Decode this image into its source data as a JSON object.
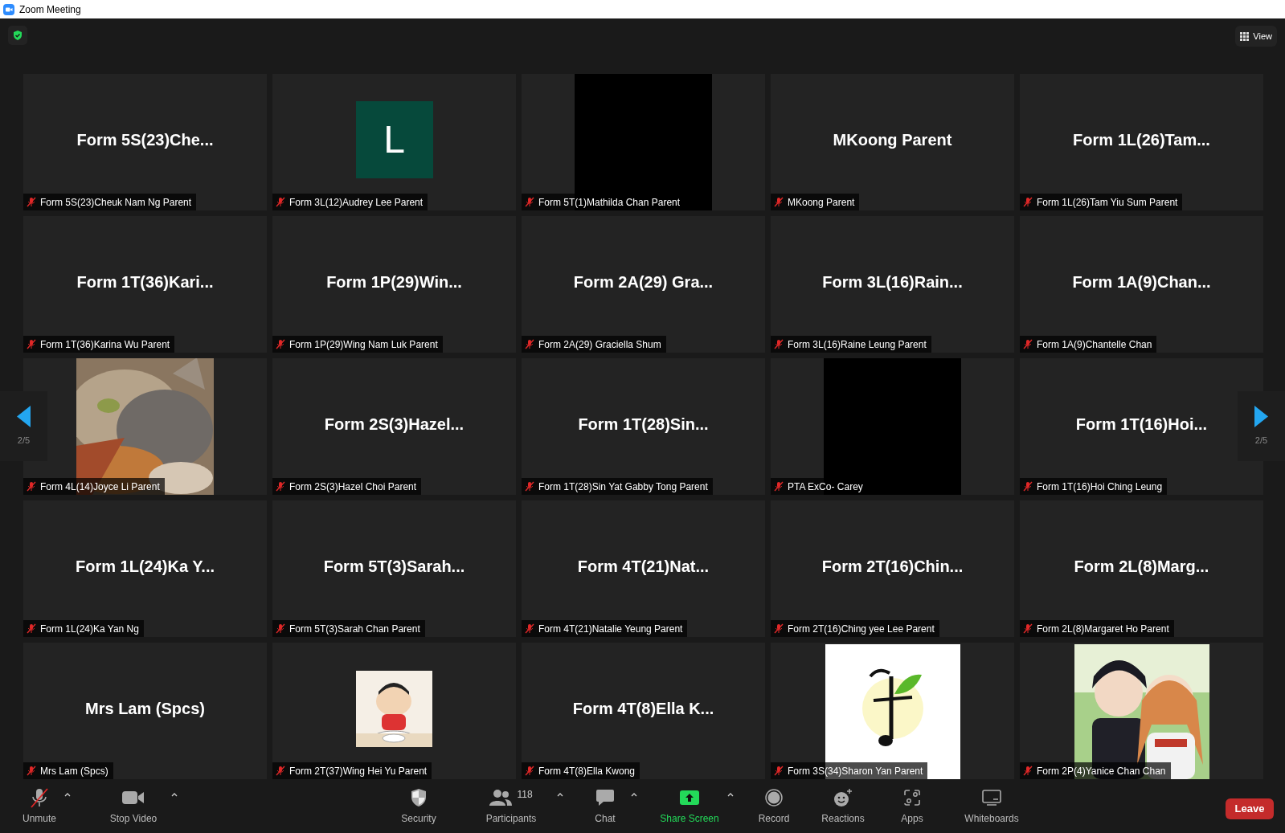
{
  "window": {
    "title": "Zoom Meeting"
  },
  "view_button": {
    "label": "View"
  },
  "pager": {
    "left": "2/5",
    "right": "2/5"
  },
  "tiles": [
    {
      "kind": "name",
      "display_name": "Form 5S(23)Che...",
      "label": "Form 5S(23)Cheuk Nam Ng Parent",
      "muted": true
    },
    {
      "kind": "avatar",
      "display_name": "L",
      "label": "Form 3L(12)Audrey Lee Parent",
      "muted": true
    },
    {
      "kind": "black_video",
      "label": "Form 5T(1)Mathilda Chan Parent",
      "muted": true
    },
    {
      "kind": "name",
      "display_name": "MKoong Parent",
      "label": "MKoong Parent",
      "muted": true
    },
    {
      "kind": "name",
      "display_name": "Form 1L(26)Tam...",
      "label": "Form 1L(26)Tam Yiu Sum Parent",
      "muted": true
    },
    {
      "kind": "name",
      "display_name": "Form 1T(36)Kari...",
      "label": "Form 1T(36)Karina Wu Parent",
      "muted": true
    },
    {
      "kind": "name",
      "display_name": "Form 1P(29)Win...",
      "label": "Form 1P(29)Wing Nam Luk Parent",
      "muted": true
    },
    {
      "kind": "name",
      "display_name": "Form 2A(29) Gra...",
      "label": "Form 2A(29) Graciella Shum",
      "muted": true
    },
    {
      "kind": "name",
      "display_name": "Form 3L(16)Rain...",
      "label": "Form 3L(16)Raine Leung Parent",
      "muted": true
    },
    {
      "kind": "name",
      "display_name": "Form 1A(9)Chan...",
      "label": "Form 1A(9)Chantelle Chan",
      "muted": true
    },
    {
      "kind": "picture",
      "label": "Form 4L(14)Joyce Li Parent",
      "muted": true
    },
    {
      "kind": "name",
      "display_name": "Form 2S(3)Hazel...",
      "label": "Form 2S(3)Hazel Choi Parent",
      "muted": true
    },
    {
      "kind": "name",
      "display_name": "Form 1T(28)Sin...",
      "label": "Form 1T(28)Sin Yat Gabby Tong Parent",
      "muted": true
    },
    {
      "kind": "black_video",
      "label": "PTA ExCo- Carey",
      "muted": true
    },
    {
      "kind": "name",
      "display_name": "Form 1T(16)Hoi...",
      "label": "Form 1T(16)Hoi Ching Leung",
      "muted": true
    },
    {
      "kind": "name",
      "display_name": "Form 1L(24)Ka Y...",
      "label": "Form 1L(24)Ka Yan Ng",
      "muted": true
    },
    {
      "kind": "name",
      "display_name": "Form 5T(3)Sarah...",
      "label": "Form 5T(3)Sarah Chan Parent",
      "muted": true
    },
    {
      "kind": "name",
      "display_name": "Form 4T(21)Nat...",
      "label": "Form 4T(21)Natalie Yeung Parent",
      "muted": true
    },
    {
      "kind": "name",
      "display_name": "Form 2T(16)Chin...",
      "label": "Form 2T(16)Ching yee Lee Parent",
      "muted": true
    },
    {
      "kind": "name",
      "display_name": "Form 2L(8)Marg...",
      "label": "Form 2L(8)Margaret Ho Parent",
      "muted": true
    },
    {
      "kind": "name",
      "display_name": "Mrs Lam (Spcs)",
      "label": "Mrs Lam (Spcs)",
      "muted": true
    },
    {
      "kind": "picture",
      "label": "Form 2T(37)Wing Hei Yu Parent",
      "muted": true
    },
    {
      "kind": "name",
      "display_name": "Form 4T(8)Ella K...",
      "label": "Form 4T(8)Ella Kwong",
      "muted": true
    },
    {
      "kind": "picture",
      "label": "Form 3S(34)Sharon Yan Parent",
      "muted": true
    },
    {
      "kind": "picture",
      "label": "Form 2P(4)Yanice Chan Chan",
      "muted": true
    }
  ],
  "toolbar": {
    "buttons": [
      {
        "kind": "mic",
        "label": "Unmute",
        "muted": true
      },
      {
        "kind": "video",
        "label": "Stop Video"
      },
      {
        "kind": "security",
        "label": "Security"
      },
      {
        "kind": "participants",
        "label": "Participants",
        "count": "118"
      },
      {
        "kind": "chat",
        "label": "Chat"
      },
      {
        "kind": "share",
        "label": "Share Screen"
      },
      {
        "kind": "record",
        "label": "Record"
      },
      {
        "kind": "reactions",
        "label": "Reactions"
      },
      {
        "kind": "apps",
        "label": "Apps"
      },
      {
        "kind": "whiteboards",
        "label": "Whiteboards"
      }
    ],
    "leave": "Leave"
  }
}
